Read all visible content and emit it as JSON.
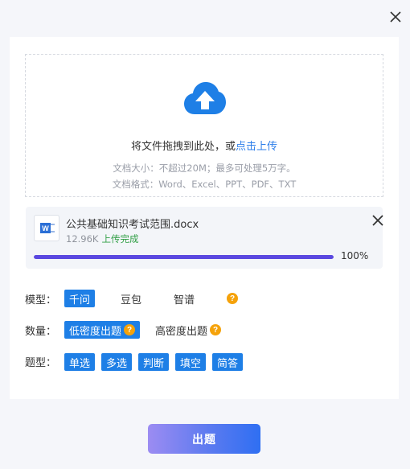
{
  "dialog": {
    "close_icon": "close-icon"
  },
  "upload": {
    "icon": "cloud-upload-icon",
    "prompt_text": "将文件拖拽到此处，或",
    "prompt_link": "点击上传",
    "hint_size": "文档大小：不超过20M；最多可处理5万字。",
    "hint_format": "文档格式：Word、Excel、PPT、PDF、TXT"
  },
  "file": {
    "icon": "word-doc-icon",
    "name": "公共基础知识考试范围.docx",
    "size": "12.96K",
    "status": "上传完成",
    "progress": 1.0,
    "progress_text": "100%",
    "remove_icon": "close-icon"
  },
  "model": {
    "label": "模型：",
    "options": [
      "千问",
      "豆包",
      "智谱"
    ],
    "selected": "千问",
    "help_icon": "question-icon",
    "help_text": "?"
  },
  "quantity": {
    "label": "数量：",
    "options": [
      "低密度出题",
      "高密度出题"
    ],
    "selected": "低密度出题",
    "help_text": "?"
  },
  "question_type": {
    "label": "题型：",
    "options": [
      "单选",
      "多选",
      "判断",
      "填空",
      "简答"
    ]
  },
  "submit": {
    "label": "出题"
  },
  "colors": {
    "accent": "#1e7fe6",
    "progress": "#5a48e0",
    "success": "#2f9e44",
    "help": "#f5a20a"
  }
}
